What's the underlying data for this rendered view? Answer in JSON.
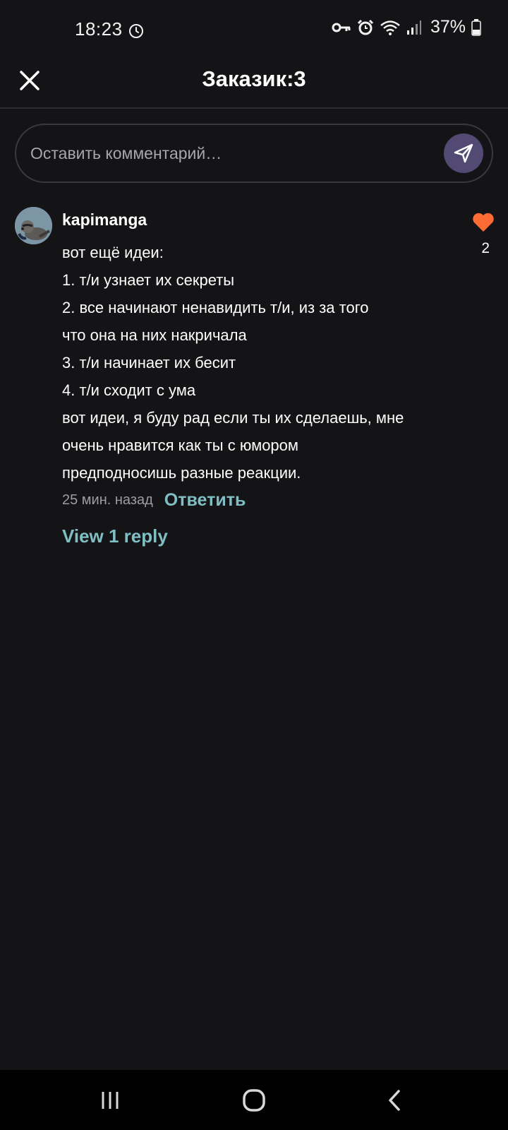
{
  "status_bar": {
    "time": "18:23",
    "battery_percent": "37%",
    "icons": [
      "alarm-clock-icon",
      "key-icon",
      "alarm-icon",
      "wifi-icon",
      "signal-icon",
      "battery-icon"
    ]
  },
  "header": {
    "title": "Заказик:3",
    "close_icon": "close-icon"
  },
  "comment_input": {
    "placeholder": "Оставить комментарий…",
    "value": "",
    "send_icon": "send-icon"
  },
  "comments": [
    {
      "username": "kapimanga",
      "lines": [
        "вот ещё идеи:",
        "1. т/и узнает их секреты",
        "2. все начинают ненавидить т/и, из за того",
        "что она на них накричала",
        "3. т/и начинает их бесит",
        "4. т/и сходит с ума",
        "вот идеи, я буду рад если ты их сделаешь, мне",
        "очень нравится как ты с юмором",
        "предподносишь разные реакции."
      ],
      "timestamp": "25 мин. назад",
      "reply_label": "Ответить",
      "view_replies_label": "View 1 reply",
      "like_count": "2",
      "liked": true
    }
  ],
  "nav_bar": {
    "buttons": [
      "recent-apps",
      "home",
      "back"
    ]
  },
  "colors": {
    "background": "#141316",
    "accent": "#7fbfc4",
    "like": "#ff6b35",
    "send_button": "#524a72"
  }
}
